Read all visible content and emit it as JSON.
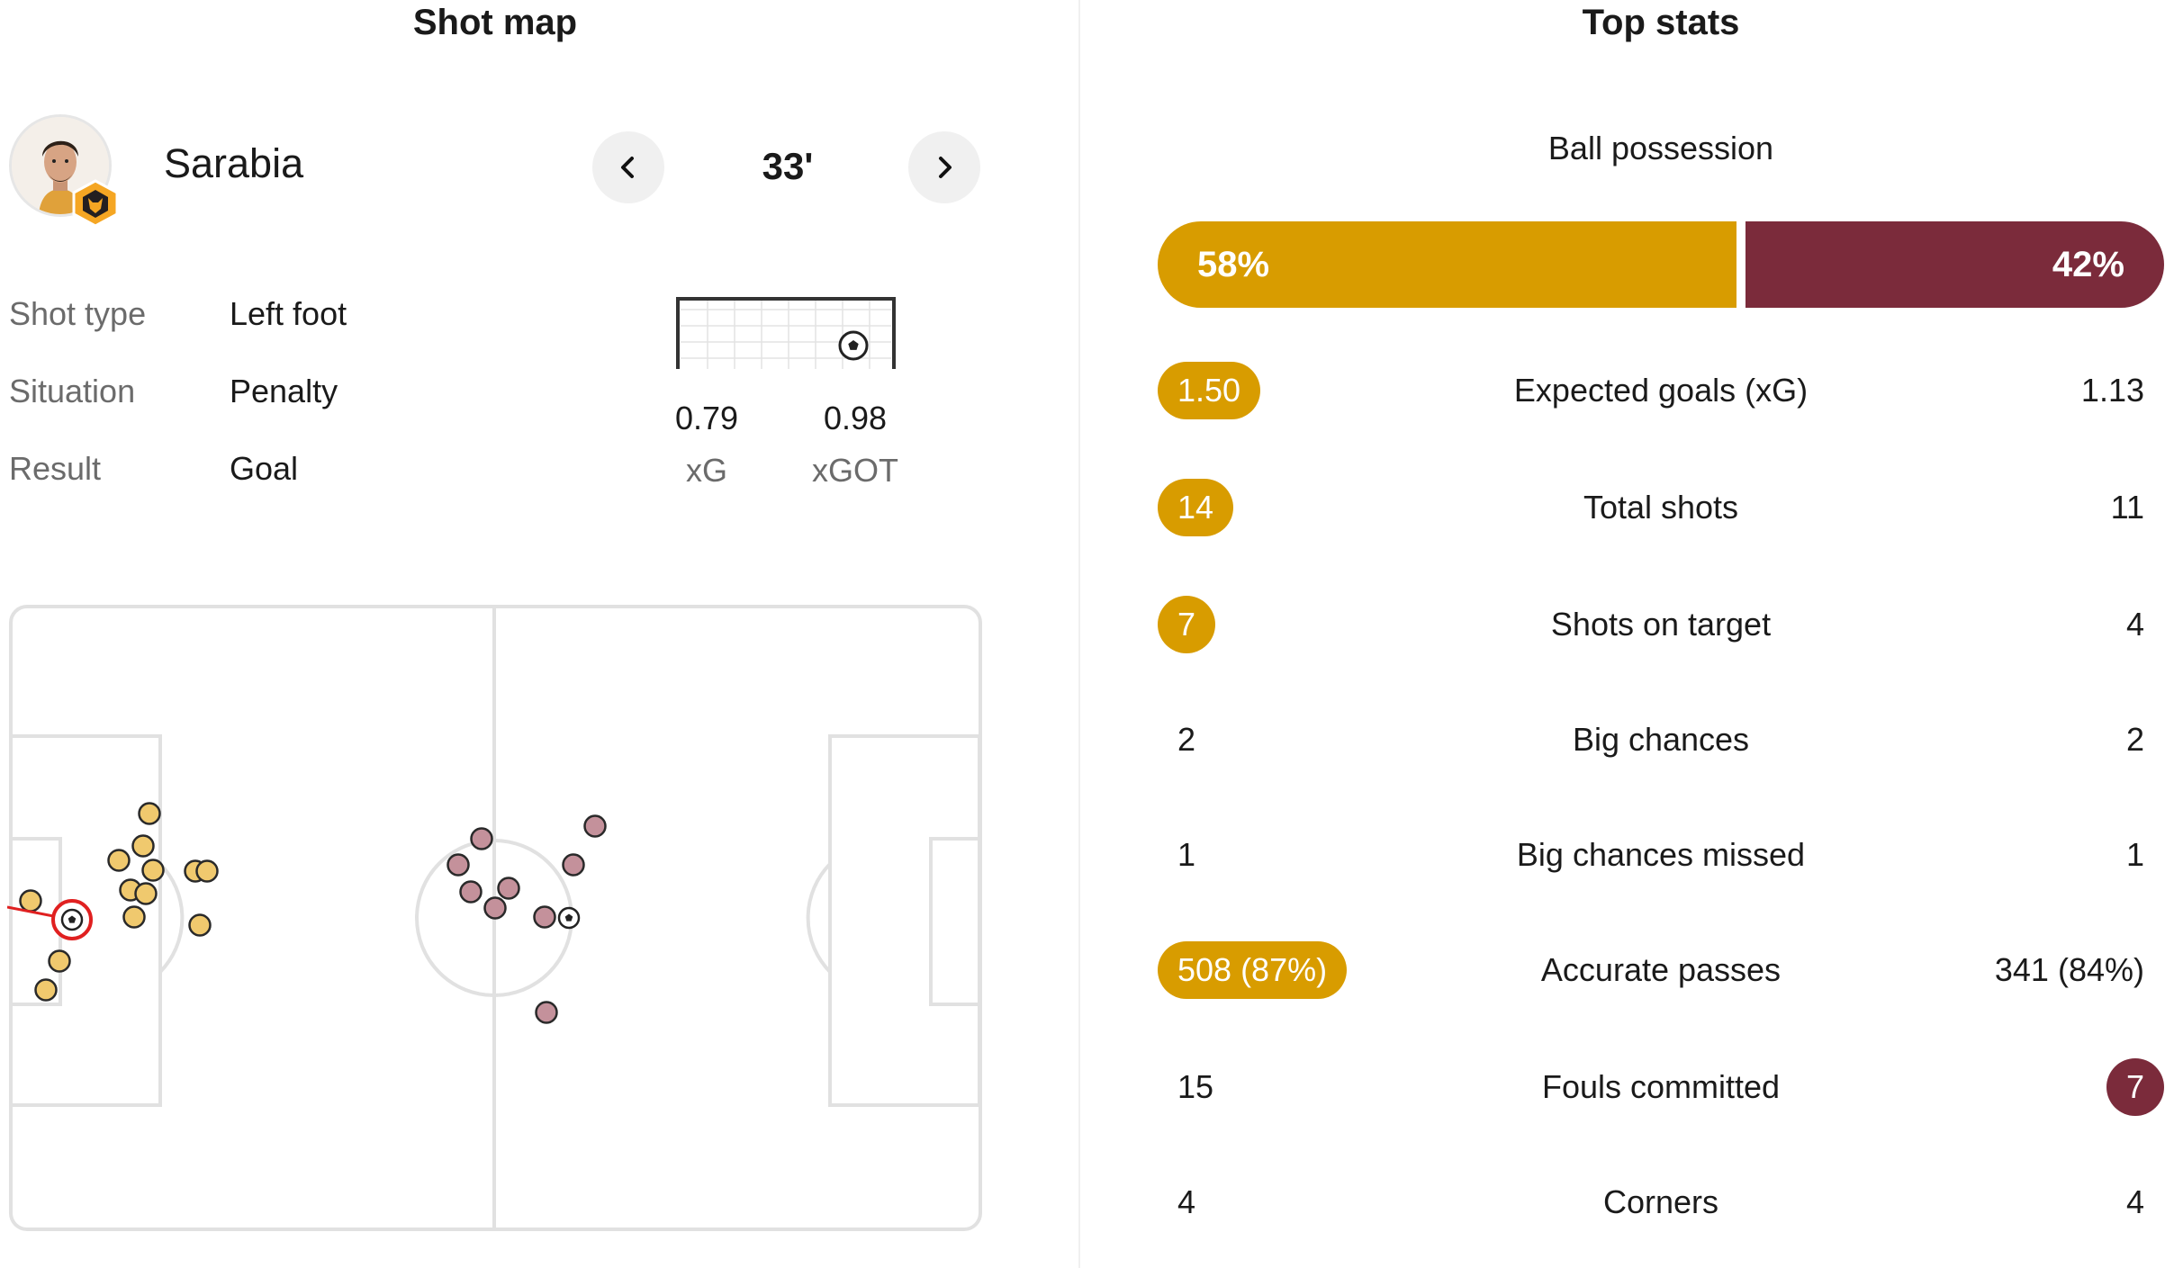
{
  "shot_map": {
    "title": "Shot map",
    "player": {
      "name": "Sarabia",
      "minute": "33'"
    },
    "details": [
      {
        "label": "Shot type",
        "value": "Left foot"
      },
      {
        "label": "Situation",
        "value": "Penalty"
      },
      {
        "label": "Result",
        "value": "Goal"
      }
    ],
    "xg": {
      "value": "0.79",
      "label": "xG"
    },
    "xgot": {
      "value": "0.98",
      "label": "xGOT"
    },
    "icons": {
      "prev": "chevron-left-icon",
      "next": "chevron-right-icon",
      "team": "wolf-crest-icon",
      "ball": "football-icon"
    },
    "colors": {
      "home": "#f0c96e",
      "away": "#c4919b",
      "selected": "#e02020"
    }
  },
  "top_stats": {
    "title": "Top stats",
    "possession": {
      "label": "Ball possession",
      "home": "58%",
      "away": "42%",
      "home_value": 58,
      "away_value": 42
    },
    "rows": [
      {
        "label": "Expected goals (xG)",
        "home": "1.50",
        "away": "1.13",
        "highlight": "home"
      },
      {
        "label": "Total shots",
        "home": "14",
        "away": "11",
        "highlight": "home"
      },
      {
        "label": "Shots on target",
        "home": "7",
        "away": "4",
        "highlight": "home"
      },
      {
        "label": "Big chances",
        "home": "2",
        "away": "2",
        "highlight": "none"
      },
      {
        "label": "Big chances missed",
        "home": "1",
        "away": "1",
        "highlight": "none"
      },
      {
        "label": "Accurate passes",
        "home": "508 (87%)",
        "away": "341 (84%)",
        "highlight": "home"
      },
      {
        "label": "Fouls committed",
        "home": "15",
        "away": "7",
        "highlight": "away"
      },
      {
        "label": "Corners",
        "home": "4",
        "away": "4",
        "highlight": "none"
      }
    ],
    "colors": {
      "home": "#d89c00",
      "away": "#7b2b3b"
    }
  }
}
